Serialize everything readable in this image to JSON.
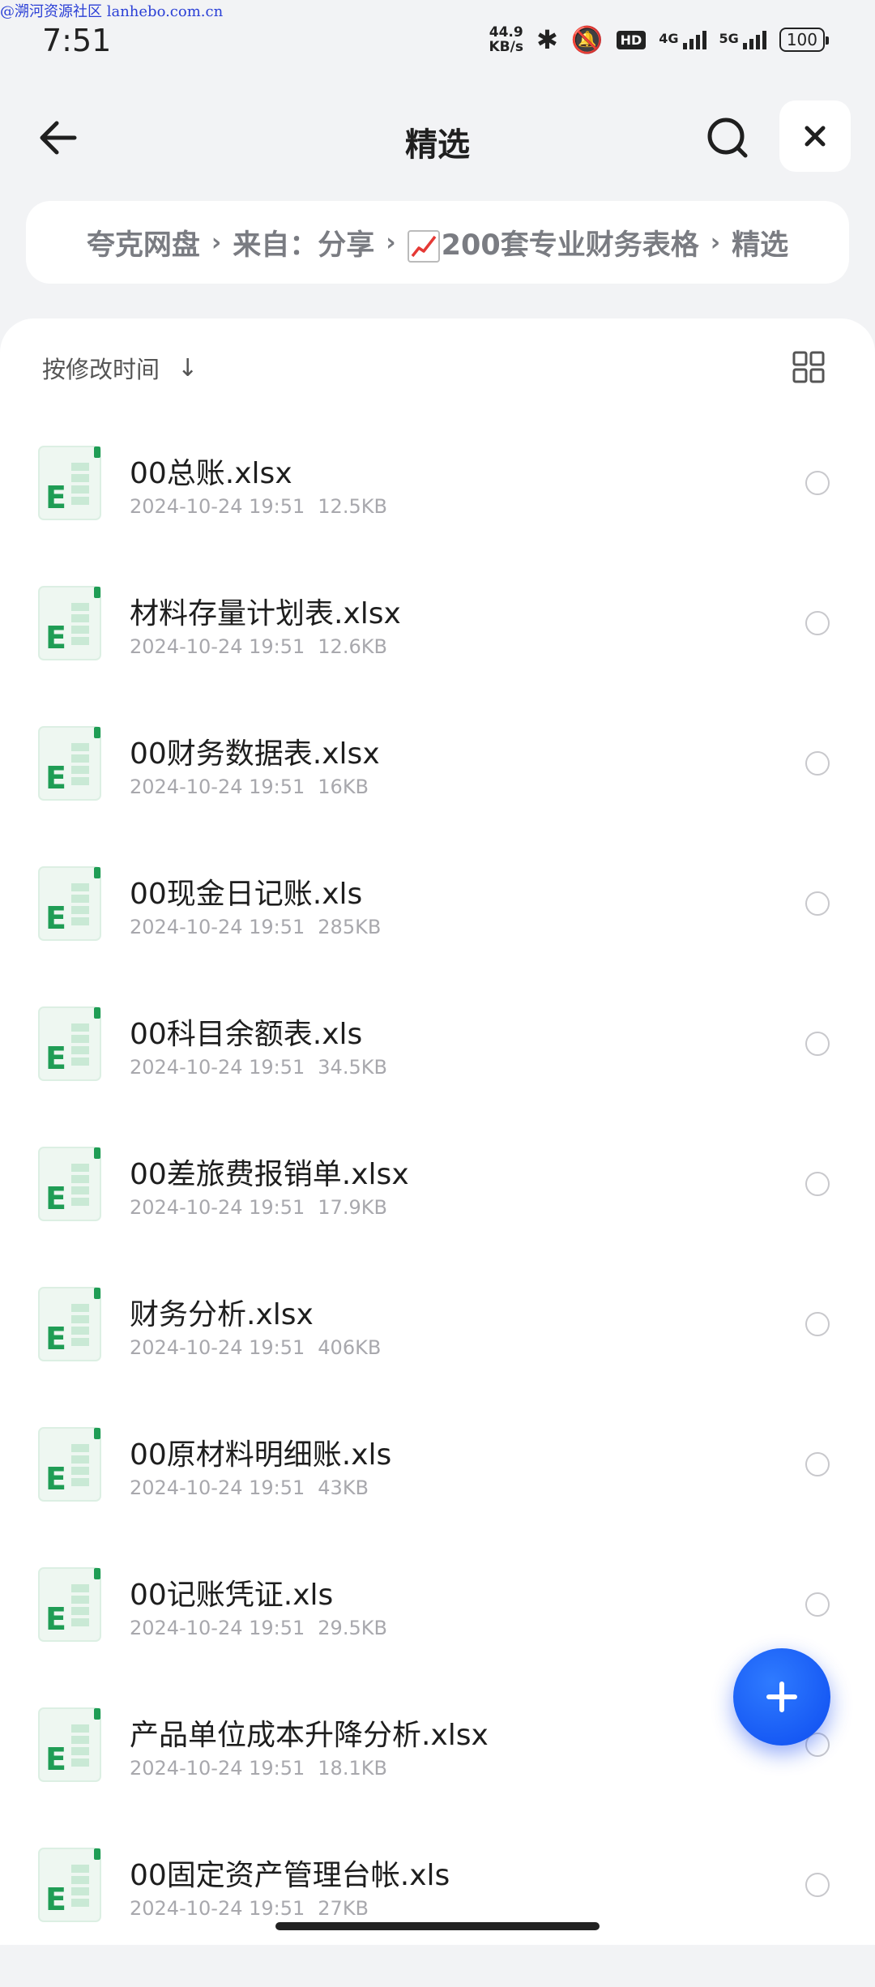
{
  "watermark": "@溯河资源社区 lanhebo.com.cn",
  "status": {
    "time": "7:51",
    "net_speed_value": "44.9",
    "net_speed_unit": "KB/s",
    "hd_label": "HD",
    "sig1_label": "4G",
    "sig2_label": "5G",
    "battery": "100"
  },
  "header": {
    "title": "精选"
  },
  "breadcrumb": {
    "items": [
      "夸克网盘",
      "来自：分享",
      "200套专业财务表格",
      "精选"
    ]
  },
  "sort": {
    "label": "按修改时间"
  },
  "files": [
    {
      "name": "00总账.xlsx",
      "date": "2024-10-24 19:51",
      "size": "12.5KB"
    },
    {
      "name": "材料存量计划表.xlsx",
      "date": "2024-10-24 19:51",
      "size": "12.6KB"
    },
    {
      "name": "00财务数据表.xlsx",
      "date": "2024-10-24 19:51",
      "size": "16KB"
    },
    {
      "name": "00现金日记账.xls",
      "date": "2024-10-24 19:51",
      "size": "285KB"
    },
    {
      "name": "00科目余额表.xls",
      "date": "2024-10-24 19:51",
      "size": "34.5KB"
    },
    {
      "name": "00差旅费报销单.xlsx",
      "date": "2024-10-24 19:51",
      "size": "17.9KB"
    },
    {
      "name": "财务分析.xlsx",
      "date": "2024-10-24 19:51",
      "size": "406KB"
    },
    {
      "name": "00原材料明细账.xls",
      "date": "2024-10-24 19:51",
      "size": "43KB"
    },
    {
      "name": "00记账凭证.xls",
      "date": "2024-10-24 19:51",
      "size": "29.5KB"
    },
    {
      "name": "产品单位成本升降分析.xlsx",
      "date": "2024-10-24 19:51",
      "size": "18.1KB"
    },
    {
      "name": "00固定资产管理台帐.xls",
      "date": "2024-10-24 19:51",
      "size": "27KB"
    }
  ],
  "colors": {
    "accent": "#1a5cff",
    "excel_green": "#1f9d55"
  }
}
